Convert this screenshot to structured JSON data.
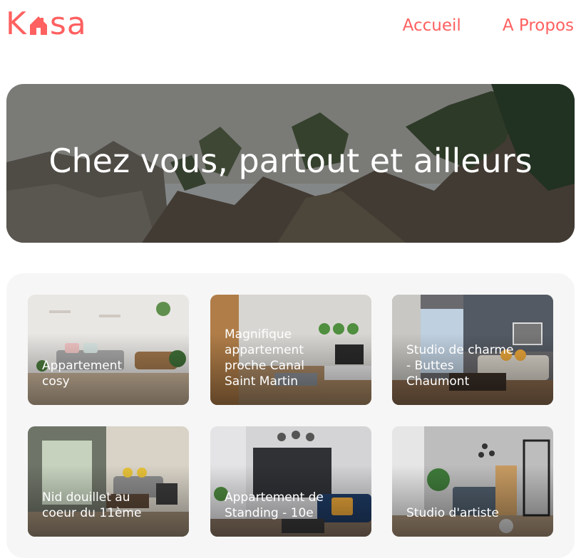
{
  "header": {
    "logo": {
      "text_left": "K",
      "text_right": "sa",
      "icon": "house-icon",
      "color": "#FF6060"
    },
    "nav": [
      {
        "label": "Accueil"
      },
      {
        "label": "A Propos"
      }
    ]
  },
  "banner": {
    "title": "Chez vous, partout et ailleurs"
  },
  "gallery": {
    "cards": [
      {
        "title": "Appartement cosy"
      },
      {
        "title": "Magnifique appartement proche Canal Saint Martin"
      },
      {
        "title": "Studio de charme - Buttes Chaumont"
      },
      {
        "title": "Nid douillet au coeur du 11ème"
      },
      {
        "title": "Appartement de Standing - 10e"
      },
      {
        "title": "Studio d'artiste"
      }
    ]
  },
  "colors": {
    "accent": "#FF6060",
    "gallery_bg": "#F6F6F6"
  }
}
